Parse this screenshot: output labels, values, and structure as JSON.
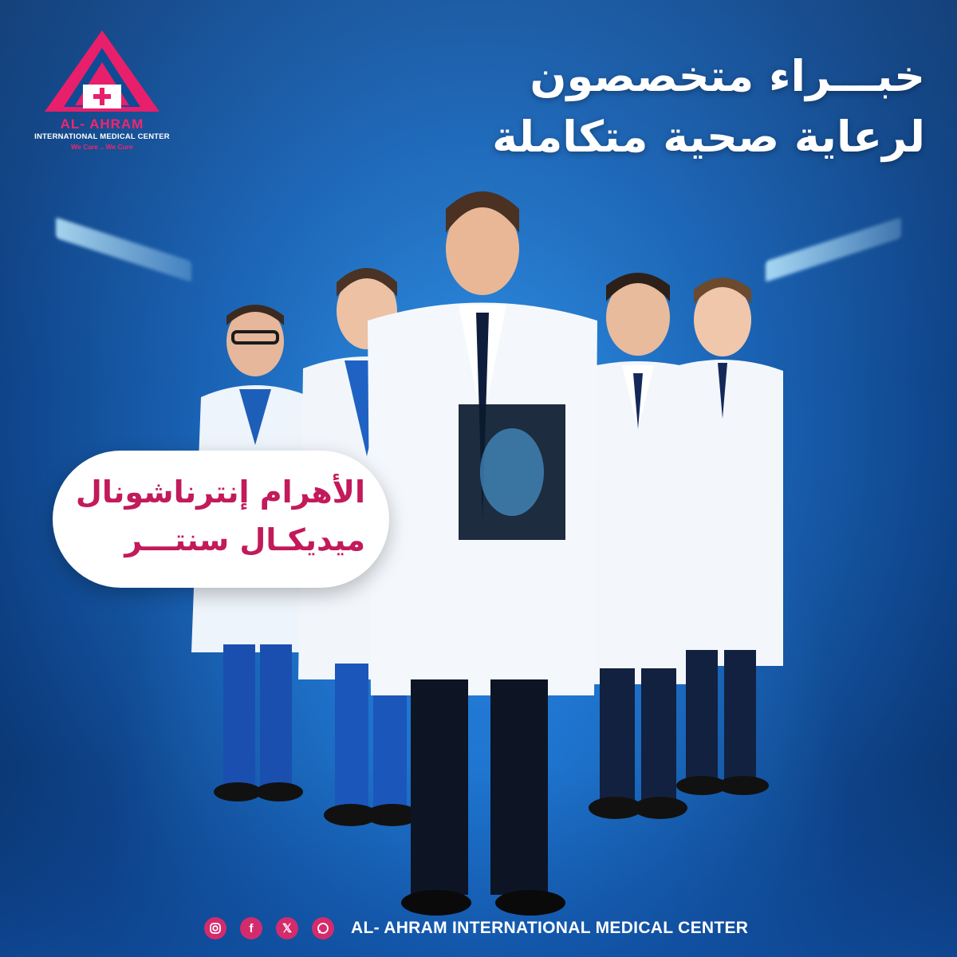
{
  "logo": {
    "name": "AL- AHRAM",
    "subtitle": "INTERNATIONAL MEDICAL CENTER",
    "tagline": "We Care .. We Cure",
    "primary_color": "#f0266f"
  },
  "headline": {
    "line1": "خبـــراء متخصصون",
    "line2": "لرعاية صحية متكاملة"
  },
  "callout": {
    "line1": "الأهرام إنترناشونال",
    "line2": "ميديكـال سنتـــر",
    "color": "#c21a5b"
  },
  "footer": {
    "icons": [
      "instagram-icon",
      "facebook-icon",
      "x-icon",
      "whatsapp-icon"
    ],
    "text": "AL- AHRAM INTERNATIONAL MEDICAL CENTER",
    "icon_color": "#d42b6c"
  },
  "photo": {
    "subject": "five-doctors-in-white-coats",
    "background_color": "#1a63b5"
  }
}
